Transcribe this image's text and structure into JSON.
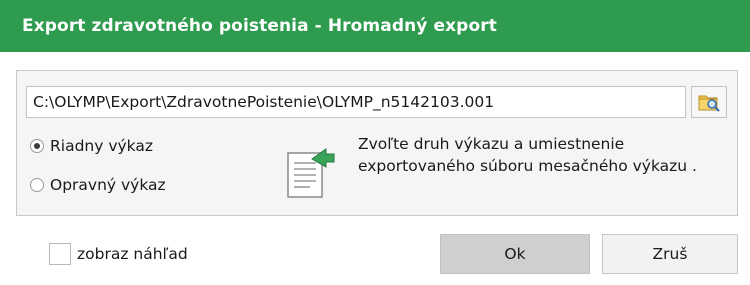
{
  "window": {
    "title": "Export zdravotného poistenia - Hromadný export",
    "title_bar_color": "#2e9b4e"
  },
  "export_path": {
    "value": "C:\\OLYMP\\Export\\ZdravotnePoistenie\\OLYMP_n5142103.001",
    "browse_icon": "folder-search-icon"
  },
  "report_type": {
    "options": [
      {
        "label": "Riadny výkaz",
        "selected": true
      },
      {
        "label": "Opravný výkaz",
        "selected": false
      }
    ]
  },
  "info": {
    "icon": "document-export-icon",
    "line1": "Zvoľte druh výkazu a umiestnenie",
    "line2": "exportovaného súboru mesačného výkazu ."
  },
  "preview": {
    "label": "zobraz náhľad",
    "checked": false
  },
  "buttons": {
    "ok": "Ok",
    "cancel": "Zruš"
  }
}
